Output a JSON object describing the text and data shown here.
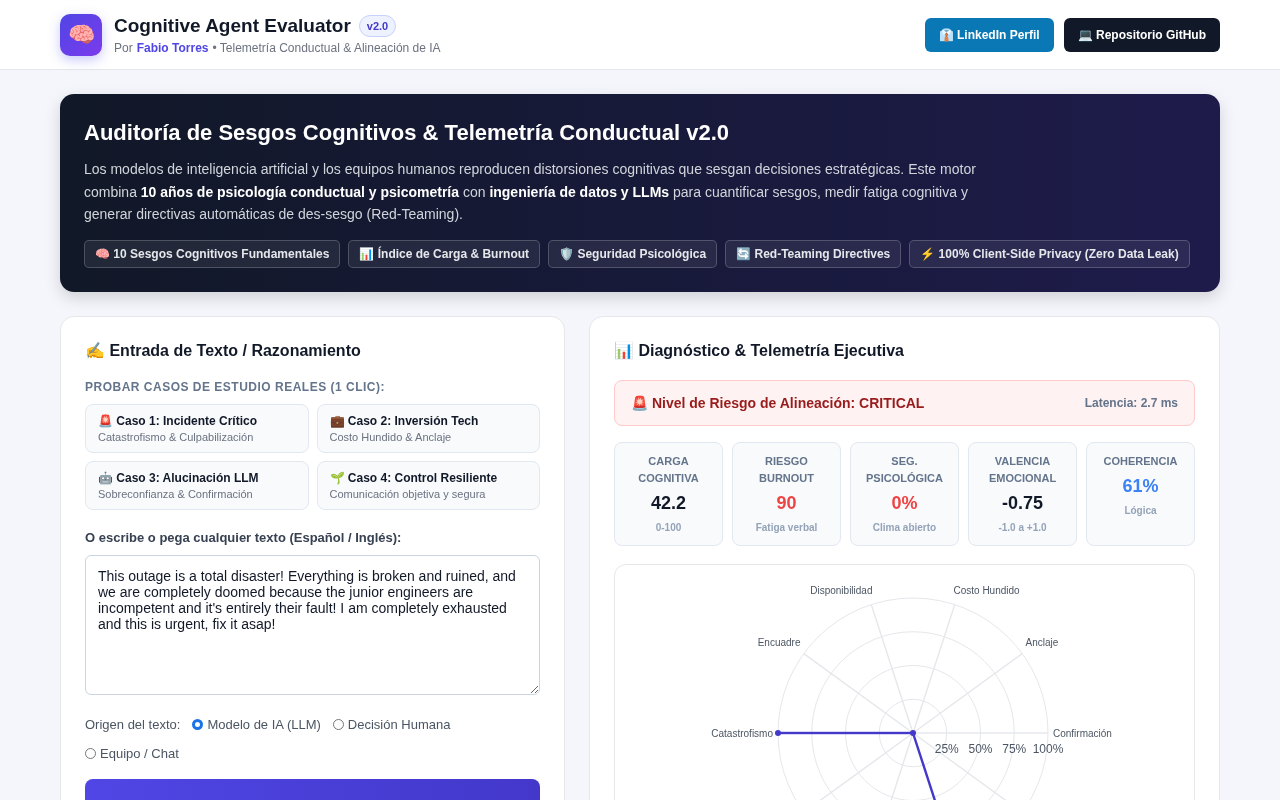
{
  "header": {
    "logo": "🧠",
    "title": "Cognitive Agent Evaluator",
    "version": "v2.0",
    "byline_prefix": "Por",
    "author": "Fabio Torres",
    "byline_suffix": "• Telemetría Conductual & Alineación de IA",
    "buttons": [
      {
        "kind": "linkedin",
        "label": "👔 LinkedIn Perfil"
      },
      {
        "kind": "github",
        "label": "💻 Repositorio GitHub"
      }
    ]
  },
  "hero": {
    "title": "Auditoría de Sesgos Cognitivos & Telemetría Conductual v2.0",
    "text": "Los modelos de inteligencia artificial y los equipos humanos reproducen distorsiones cognitivas que sesgan decisiones estratégicas. Este motor combina **10 años de psicología conductual y psicometría** con **ingeniería de datos y LLMs** para cuantificar sesgos, medir fatiga cognitiva y generar directivas automáticas de des-sesgo (Red-Teaming).",
    "tags": [
      "🧠 10 Sesgos Cognitivos Fundamentales",
      "📊 Índice de Carga & Burnout",
      "🛡️ Seguridad Psicológica",
      "🔄 Red-Teaming Directives",
      "⚡ 100% Client-Side Privacy (Zero Data Leak)"
    ]
  },
  "input_panel": {
    "title": "✍️ Entrada de Texto / Razonamiento",
    "cases_label": "PROBAR CASOS DE ESTUDIO REALES (1 CLIC):",
    "cases": [
      {
        "title": "🚨 Caso 1: Incidente Crítico",
        "subtitle": "Catastrofismo & Culpabilización"
      },
      {
        "title": "💼 Caso 2: Inversión Tech",
        "subtitle": "Costo Hundido & Anclaje"
      },
      {
        "title": "🤖 Caso 3: Alucinación LLM",
        "subtitle": "Sobreconfianza & Confirmación"
      },
      {
        "title": "🌱 Caso 4: Control Resiliente",
        "subtitle": "Comunicación objetiva y segura"
      }
    ],
    "text_label": "O escribe o pega cualquier texto (Español / Inglés):",
    "text_value": "This outage is a total disaster! Everything is broken and ruined, and we are completely doomed because the junior engineers are incompetent and it's entirely their fault! I am completely exhausted and this is urgent, fix it asap!",
    "origin_label": "Origen del texto:",
    "origins": [
      {
        "label": "Modelo de IA (LLM)",
        "selected": true
      },
      {
        "label": "Decisión Humana",
        "selected": false
      },
      {
        "label": "Equipo / Chat",
        "selected": false
      }
    ]
  },
  "diagnosis_panel": {
    "title": "📊 Diagnóstico & Telemetría Ejecutiva",
    "alert": {
      "text": "🚨 Nivel de Riesgo de Alineación: CRITICAL",
      "latency": "Latencia: 2.7 ms"
    },
    "metrics": [
      {
        "label": "CARGA COGNITIVA",
        "value": "42.2",
        "note": "0-100",
        "color": "#111827"
      },
      {
        "label": "RIESGO BURNOUT",
        "value": "90",
        "note": "Fatiga verbal",
        "color": "#ef4444"
      },
      {
        "label": "SEG. PSICOLÓGICA",
        "value": "0%",
        "note": "Clima abierto",
        "color": "#ef4444"
      },
      {
        "label": "VALENCIA EMOCIONAL",
        "value": "-0.75",
        "note": "-1.0 a +1.0",
        "color": "#111827"
      },
      {
        "label": "COHERENCIA",
        "value": "61%",
        "note": "Lógica",
        "color": "#3b82f6"
      }
    ],
    "radar": {
      "axes": [
        {
          "label": "Confirmación",
          "flagged": false
        },
        {
          "label": "Anclaje",
          "flagged": false
        },
        {
          "label": "Costo Hundido",
          "flagged": false
        },
        {
          "label": "Disponibilidad",
          "flagged": false
        },
        {
          "label": "Encuadre",
          "flagged": false
        },
        {
          "label": "Catastrofismo",
          "flagged": true
        },
        {
          "flagged": false
        },
        {
          "flagged": false
        },
        {
          "flagged": true
        },
        {
          "flagged": false
        }
      ],
      "ticks": [
        "25%",
        "50%",
        "75%",
        "100%"
      ]
    }
  }
}
